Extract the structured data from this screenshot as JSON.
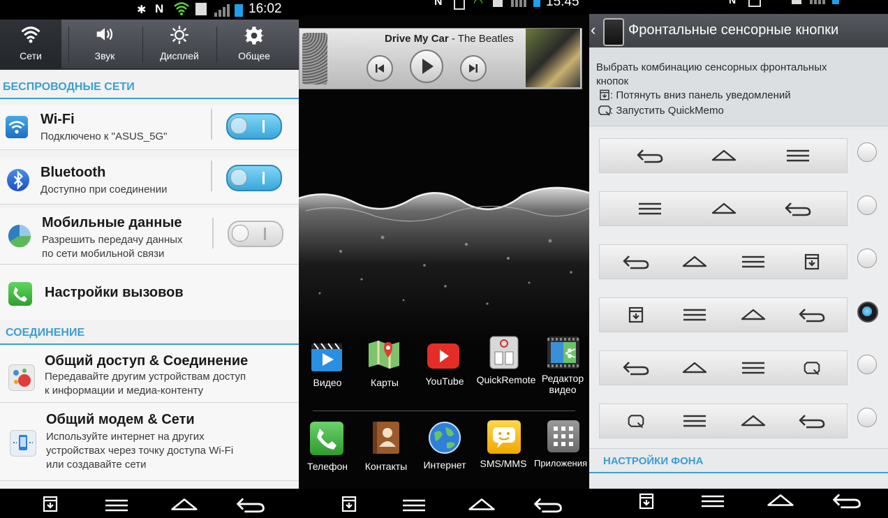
{
  "panel1": {
    "time": "16:02",
    "tabs": [
      {
        "label": "Сети",
        "icon": "wifi-icon"
      },
      {
        "label": "Звук",
        "icon": "speaker-icon"
      },
      {
        "label": "Дисплей",
        "icon": "brightness-icon"
      },
      {
        "label": "Общее",
        "icon": "gear-icon"
      }
    ],
    "section_wireless": "БЕСПРОВОДНЫЕ СЕТИ",
    "wifi": {
      "title": "Wi-Fi",
      "subtitle": "Подключено к \"ASUS_5G\"",
      "enabled": true
    },
    "bluetooth": {
      "title": "Bluetooth",
      "subtitle": "Доступно при соединении",
      "enabled": true
    },
    "mobile": {
      "title": "Мобильные данные",
      "subtitle1": "Разрешить передачу данных",
      "subtitle2": "по сети мобильной связи",
      "enabled": false
    },
    "calls": {
      "title": "Настройки вызовов"
    },
    "section_connection": "СОЕДИНЕНИЕ",
    "share": {
      "title": "Общий доступ & Соединение",
      "subtitle1": "Передавайте другим устройствам доступ",
      "subtitle2": "к информации и медиа-контенту"
    },
    "modem": {
      "title": "Общий модем & Сети",
      "subtitle1": "Используйте интернет на других",
      "subtitle2": "устройствах через точку доступа Wi-Fi",
      "subtitle3": "или создавайте сети"
    }
  },
  "panel2": {
    "time": "15:45",
    "player": {
      "song": "Drive My Car",
      "separator": " - ",
      "artist": "The Beatles"
    },
    "apps_row1": [
      {
        "label": "Видео",
        "icon": "video-app-icon"
      },
      {
        "label": "Карты",
        "icon": "maps-app-icon"
      },
      {
        "label": "YouTube",
        "icon": "youtube-app-icon"
      },
      {
        "label": "QuickRemote",
        "icon": "quickremote-app-icon"
      },
      {
        "label1": "Редактор",
        "label2": "видео",
        "icon": "video-editor-app-icon"
      }
    ],
    "apps_row2": [
      {
        "label": "Телефон",
        "icon": "phone-app-icon"
      },
      {
        "label": "Контакты",
        "icon": "contacts-app-icon"
      },
      {
        "label": "Интернет",
        "icon": "internet-app-icon"
      },
      {
        "label": "SMS/MMS",
        "icon": "sms-app-icon"
      },
      {
        "label": "Приложения",
        "icon": "apps-grid-icon"
      }
    ]
  },
  "panel3": {
    "title": "Фронтальные сенсорные кнопки",
    "desc_line1": "Выбрать комбинацию сенсорных фронтальных",
    "desc_line2": "кнопок",
    "desc_line3": ": Потянуть вниз панель уведомлений",
    "desc_line4": ": Запустить QuickMemo",
    "options": [
      {
        "buttons": [
          "back",
          "home",
          "menu"
        ],
        "selected": false
      },
      {
        "buttons": [
          "menu",
          "home",
          "back"
        ],
        "selected": false
      },
      {
        "buttons": [
          "back",
          "home",
          "menu",
          "notification"
        ],
        "selected": false
      },
      {
        "buttons": [
          "notification",
          "menu",
          "home",
          "back"
        ],
        "selected": true
      },
      {
        "buttons": [
          "back",
          "home",
          "menu",
          "quickmemo"
        ],
        "selected": false
      },
      {
        "buttons": [
          "quickmemo",
          "menu",
          "home",
          "back"
        ],
        "selected": false
      }
    ],
    "section_background": "НАСТРОЙКИ ФОНА"
  },
  "colors": {
    "accent": "#3a9fd0",
    "toggle_on": "#3aa7db"
  }
}
